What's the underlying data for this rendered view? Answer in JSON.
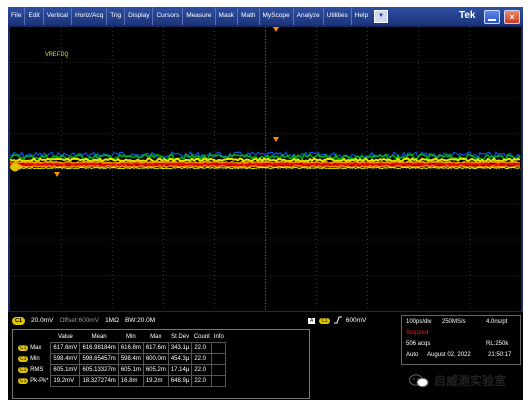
{
  "menu": {
    "items": [
      "File",
      "Edit",
      "Vertical",
      "Horiz/Acq",
      "Trig",
      "Display",
      "Cursors",
      "Measure",
      "Mask",
      "Math",
      "MyScope",
      "Analyze",
      "Utilities",
      "Help"
    ],
    "dropdown_icon": "chevron-down-icon",
    "brand": "Tek"
  },
  "waveform": {
    "label": "VREFDQ",
    "trace_colors": [
      "#ff0000",
      "#ffa500",
      "#ffff00",
      "#00c000",
      "#0060ff"
    ]
  },
  "channel": {
    "chip": "C1",
    "scale": "20.0mV",
    "offset": "Offset:600mV",
    "impedance": "1MΩ",
    "bandwidth": "BW:20.0M"
  },
  "measurements": {
    "headers": [
      "",
      "Value",
      "Mean",
      "Min",
      "Max",
      "St Dev",
      "Count",
      "Info"
    ],
    "rows": [
      {
        "chip": "C1",
        "name": "Max",
        "value": "617.6mV",
        "mean": "616.98184m",
        "min": "616.8m",
        "max": "617.6m",
        "stdev": "343.1μ",
        "count": "22.0",
        "info": ""
      },
      {
        "chip": "C1",
        "name": "Min",
        "value": "598.4mV",
        "mean": "598.65457m",
        "min": "598.4m",
        "max": "600.0m",
        "stdev": "454.3μ",
        "count": "22.0",
        "info": ""
      },
      {
        "chip": "C1",
        "name": "RMS",
        "value": "605.1mV",
        "mean": "605.13327m",
        "min": "605.1m",
        "max": "605.2m",
        "stdev": "17.14μ",
        "count": "22.0",
        "info": ""
      },
      {
        "chip": "C1",
        "name": "Pk-Pk*",
        "value": "19.2mV",
        "mean": "18.327274m",
        "min": "16.8m",
        "max": "19.2m",
        "stdev": "648.9μ",
        "count": "22.0",
        "info": ""
      }
    ]
  },
  "trigger": {
    "a_label": "A",
    "chip": "C1",
    "level": "600mV"
  },
  "acquisition": {
    "timebase": "100ps/div",
    "sample_rate": "250MS/s",
    "resolution": "4.0ns/pt",
    "status": "Stopped",
    "acqs": "506 acqs",
    "record_length": "RL:250k",
    "mode": "Auto",
    "date": "August 02, 2022",
    "time": "21:50:17"
  },
  "watermark": "启威测实验室",
  "colors": {
    "channel_yellow": "#e2c400",
    "stopped_red": "#e02020",
    "title_bar": "#1c347a"
  }
}
